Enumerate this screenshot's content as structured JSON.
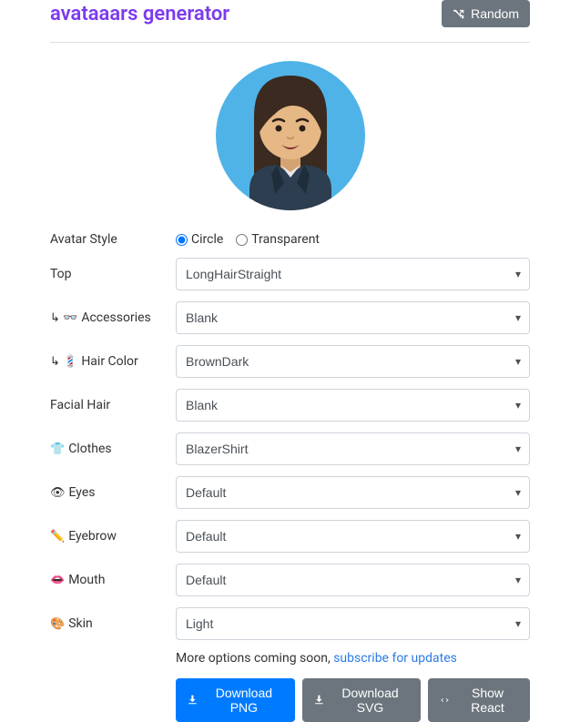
{
  "header": {
    "title": "avataaars generator",
    "random": "Random"
  },
  "avatarStyle": {
    "label": "Avatar Style",
    "options": {
      "circle": "Circle",
      "transparent": "Transparent"
    },
    "selected": "circle"
  },
  "fields": [
    {
      "icon": "",
      "label": "Top",
      "value": "LongHairStraight"
    },
    {
      "icon": "↳ 👓",
      "label": "Accessories",
      "value": "Blank"
    },
    {
      "icon": "↳ 💈",
      "label": "Hair Color",
      "value": "BrownDark"
    },
    {
      "icon": "",
      "label": "Facial Hair",
      "value": "Blank"
    },
    {
      "icon": "👕",
      "label": "Clothes",
      "value": "BlazerShirt"
    },
    {
      "icon": "👁",
      "label": "Eyes",
      "value": "Default"
    },
    {
      "icon": "✏️",
      "label": "Eyebrow",
      "value": "Default"
    },
    {
      "icon": "👄",
      "label": "Mouth",
      "value": "Default"
    },
    {
      "icon": "🎨",
      "label": "Skin",
      "value": "Light"
    }
  ],
  "more": {
    "text": "More options coming soon, ",
    "link": "subscribe for updates"
  },
  "buttons": {
    "png": "Download PNG",
    "svg": "Download SVG",
    "react": "Show React"
  }
}
